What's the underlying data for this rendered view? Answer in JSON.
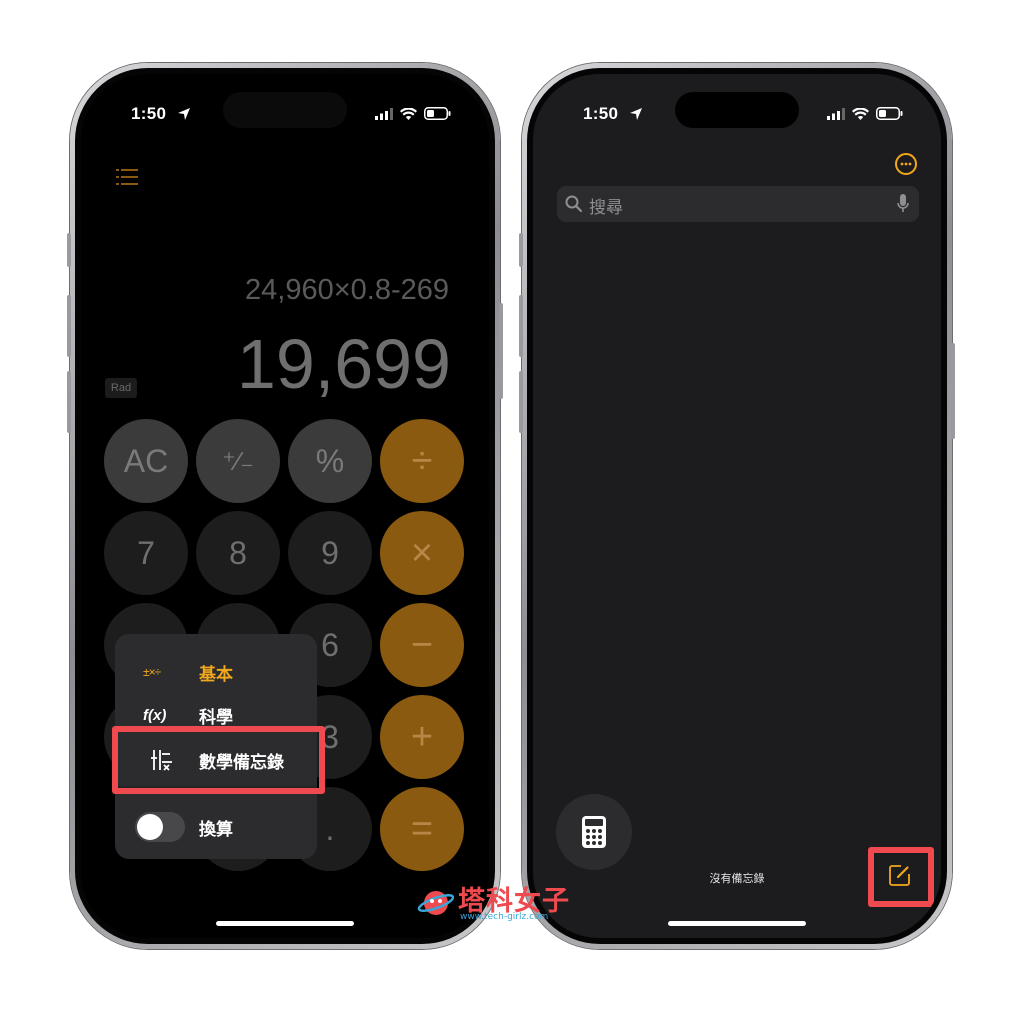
{
  "calculator": {
    "status_time": "1:50",
    "expression": "24,960×0.8-269",
    "result": "19,699",
    "angle_mode": "Rad",
    "keys": {
      "ac": "AC",
      "plus_minus": "⁺∕₋",
      "percent": "%",
      "divide": "÷",
      "seven": "7",
      "eight": "8",
      "nine": "9",
      "multiply": "×",
      "six": "6",
      "minus": "−",
      "three": "3",
      "plus": "+",
      "decimal": ".",
      "equals": "="
    },
    "menu": {
      "basic_icon": "±×÷",
      "basic": "基本",
      "scientific_icon": "f(x)",
      "scientific": "科學",
      "math_notes": "數學備忘錄",
      "convert": "換算"
    }
  },
  "notes": {
    "status_time": "1:50",
    "search_placeholder": "搜尋",
    "empty_text": "沒有備忘錄"
  },
  "watermark": {
    "brand": "塔科女子",
    "url": "www.tech-girlz.com"
  },
  "colors": {
    "accent_orange": "#f2a81d",
    "highlight_red": "#ef4a4f"
  },
  "icons": [
    "list-icon",
    "location-arrow-icon",
    "signal-icon",
    "wifi-icon",
    "battery-icon",
    "more-icon",
    "search-icon",
    "mic-icon",
    "calculator-icon",
    "compose-icon",
    "math-notes-icon"
  ]
}
